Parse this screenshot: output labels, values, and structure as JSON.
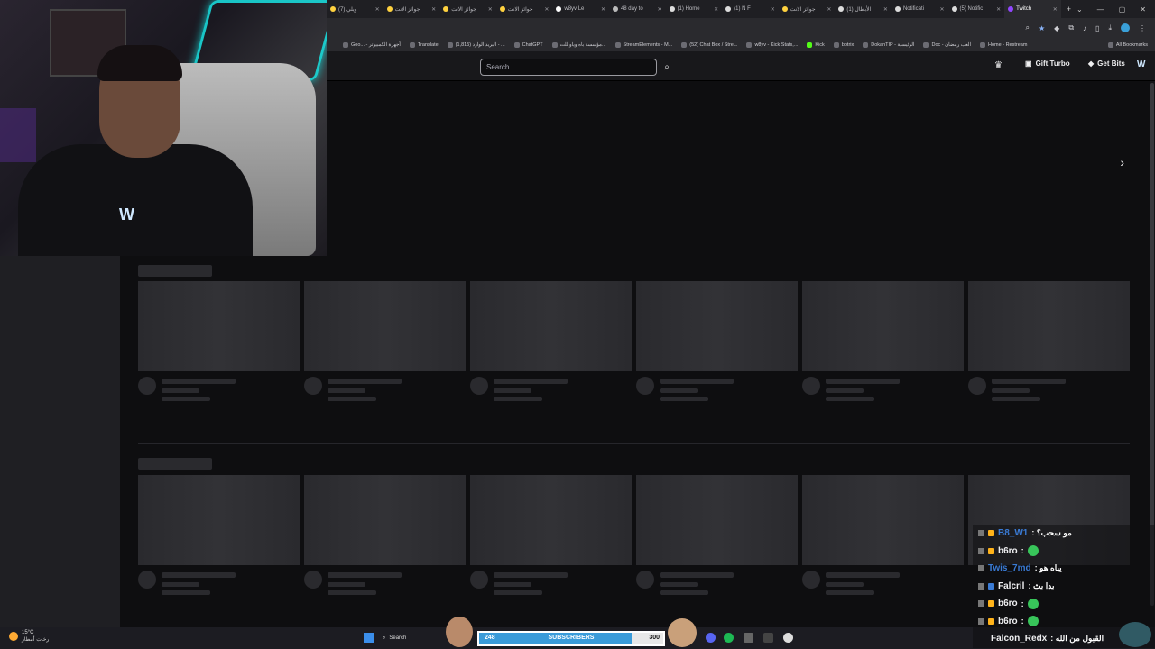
{
  "browser": {
    "tabs": [
      {
        "label": "(7) ويلي"
      },
      {
        "label": "جوائز الانت"
      },
      {
        "label": "جوائز الانت"
      },
      {
        "label": "جوائز الانت"
      },
      {
        "label": "w8yv Le"
      },
      {
        "label": "48 day to"
      },
      {
        "label": "(1) Home"
      },
      {
        "label": "(1) N F |"
      },
      {
        "label": "جوائز الانت"
      },
      {
        "label": "(1) الأبطال"
      },
      {
        "label": "Notificati"
      },
      {
        "label": "(5) Notific"
      },
      {
        "label": "Twitch"
      }
    ],
    "active_tab_label": "Twitch",
    "bookmarks": [
      "Goo... - أجهزة الكمبيوتر",
      "Translate",
      "(1,815) البريد الوارد - ...",
      "ChatGPT",
      "مؤسسة باه وياو للت...",
      "StreamElements - M...",
      "(52) Chat Box / Stre...",
      "w8yv - Kick Stats,...",
      "Kick",
      "botrix",
      "DokanTIP - الرئيسية",
      "Doc - العب رمضان",
      "Home - Restream"
    ],
    "all_bookmarks": "All Bookmarks"
  },
  "twitch": {
    "search_placeholder": "Search",
    "gift_turbo": "Gift Turbo",
    "get_bits": "Get Bits"
  },
  "chat": [
    {
      "user": "B8_W1",
      "user_color": "#3a7bd5",
      "message": "مو سحب؟"
    },
    {
      "user": "b6ro",
      "user_color": "#ffffff",
      "message": ""
    },
    {
      "user": "Twis_7md",
      "user_color": "#3a7bd5",
      "message": "يباه هو"
    },
    {
      "user": "Falcril",
      "user_color": "#ffffff",
      "message": "بدا بث"
    },
    {
      "user": "b6ro",
      "user_color": "#ffffff",
      "message": ""
    },
    {
      "user": "b6ro",
      "user_color": "#ffffff",
      "message": ""
    },
    {
      "user": "Falcon_Redx",
      "user_color": "#ffffff",
      "message": "القبول من الله"
    }
  ],
  "taskbar": {
    "weather_temp": "15°C",
    "weather_desc": "رخات أمطار",
    "search_label": "Search",
    "subscribers": {
      "count": "248",
      "label": "SUBSCRIBERS",
      "goal": "300",
      "progress": 0.83
    }
  },
  "colors": {
    "accent": "#9146ff",
    "neon": "#19e3e3",
    "sub_fill": "#3a9bd9"
  }
}
